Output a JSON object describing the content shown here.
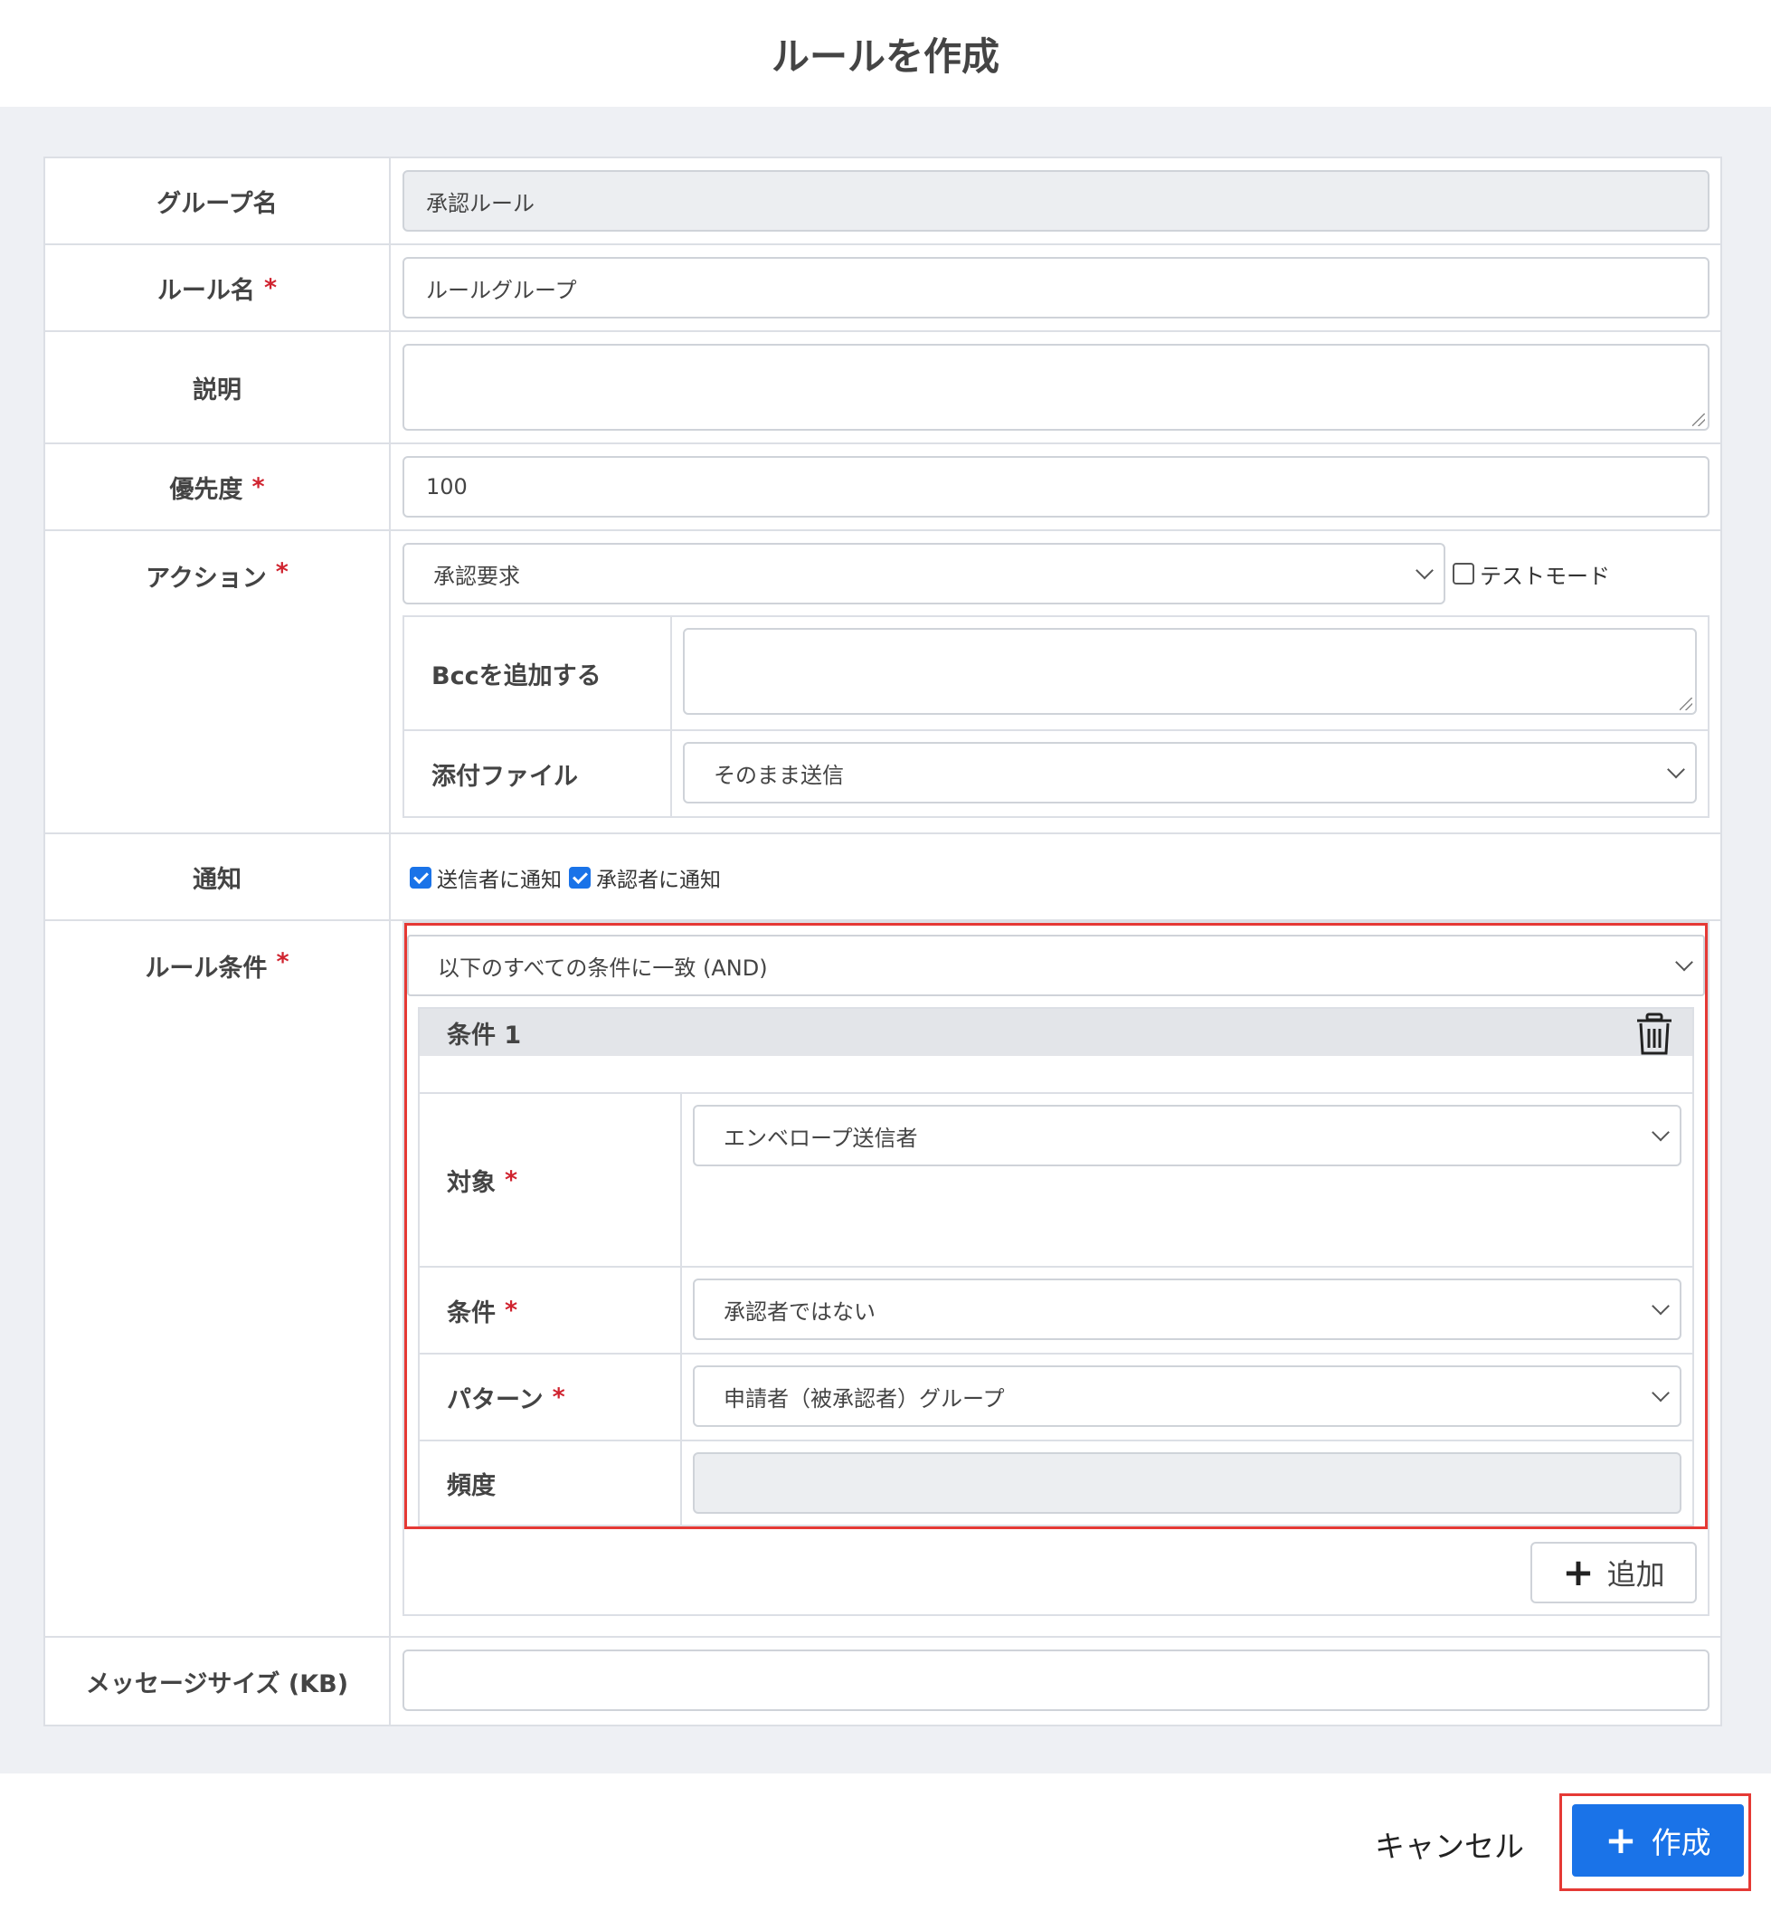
{
  "dialog": {
    "title": "ルールを作成"
  },
  "fields": {
    "group_name": {
      "label": "グループ名",
      "value": "承認ルール"
    },
    "rule_name": {
      "label": "ルール名",
      "required": "*",
      "value": "ルールグループ"
    },
    "description": {
      "label": "説明",
      "value": ""
    },
    "priority": {
      "label": "優先度",
      "required": "*",
      "value": "100"
    },
    "action": {
      "label": "アクション",
      "required": "*",
      "value": "承認要求",
      "test_mode_label": "テストモード",
      "test_mode_checked": false,
      "bcc": {
        "label": "Bccを追加する",
        "value": ""
      },
      "attachment": {
        "label": "添付ファイル",
        "value": "そのまま送信"
      }
    },
    "notify": {
      "label": "通知",
      "sender_label": "送信者に通知",
      "sender_checked": true,
      "approver_label": "承認者に通知",
      "approver_checked": true
    },
    "rule_conditions": {
      "label": "ルール条件",
      "required": "*",
      "match_mode": "以下のすべての条件に一致 (AND)",
      "condition": {
        "title": "条件 1",
        "target": {
          "label": "対象",
          "required": "*",
          "value": "エンベロープ送信者"
        },
        "operator": {
          "label": "条件",
          "required": "*",
          "value": "承認者ではない"
        },
        "pattern": {
          "label": "パターン",
          "required": "*",
          "value": "申請者（被承認者）グループ"
        },
        "frequency": {
          "label": "頻度",
          "value": ""
        }
      },
      "add_label": "追加"
    },
    "message_size": {
      "label": "メッセージサイズ (KB)",
      "value": ""
    }
  },
  "footer": {
    "cancel_label": "キャンセル",
    "create_label": "作成"
  },
  "colors": {
    "primary": "#1a73e8",
    "highlight": "#e53935",
    "required": "#d0232f"
  }
}
